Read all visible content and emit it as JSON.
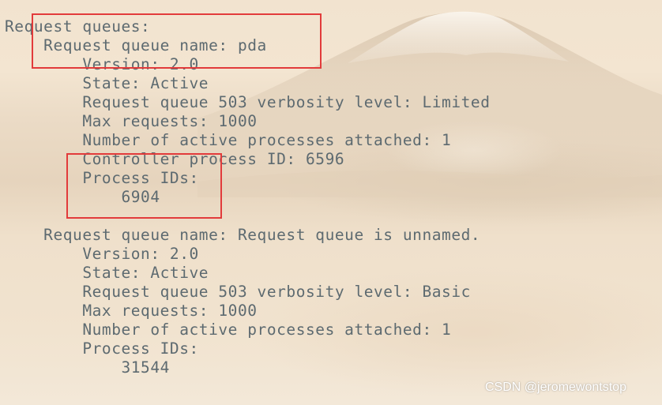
{
  "terminal": {
    "lines": [
      "Request queues:",
      "    Request queue name: pda",
      "        Version: 2.0",
      "        State: Active",
      "        Request queue 503 verbosity level: Limited",
      "        Max requests: 1000",
      "        Number of active processes attached: 1",
      "        Controller process ID: 6596",
      "        Process IDs:",
      "            6904",
      "",
      "    Request queue name: Request queue is unnamed.",
      "        Version: 2.0",
      "        State: Active",
      "        Request queue 503 verbosity level: Basic",
      "        Max requests: 1000",
      "        Number of active processes attached: 1",
      "        Process IDs:",
      "            31544"
    ]
  },
  "annotations": {
    "box_color": "#e23b3b"
  },
  "watermark": {
    "text": "CSDN @jeromewontstop"
  },
  "colors": {
    "text": "#5d6a70",
    "background": "#f4e8d6"
  }
}
